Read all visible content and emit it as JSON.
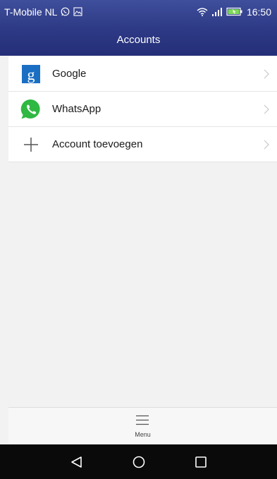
{
  "status_bar": {
    "carrier": "T-Mobile NL",
    "time": "16:50",
    "icons": [
      "whatsapp-notification-icon",
      "image-notification-icon",
      "wifi-icon",
      "signal-icon",
      "battery-icon"
    ]
  },
  "header": {
    "title": "Accounts",
    "color": "#2e3a86"
  },
  "accounts": [
    {
      "label": "Google",
      "icon": "google-icon",
      "icon_color": "#1a6fc2"
    },
    {
      "label": "WhatsApp",
      "icon": "whatsapp-icon",
      "icon_color": "#2fb842"
    },
    {
      "label": "Account toevoegen",
      "icon": "plus-icon"
    }
  ],
  "bottom_menu": {
    "label": "Menu",
    "icon": "hamburger-icon"
  },
  "navigation": {
    "buttons": [
      "back-icon",
      "home-icon",
      "recents-icon"
    ]
  }
}
